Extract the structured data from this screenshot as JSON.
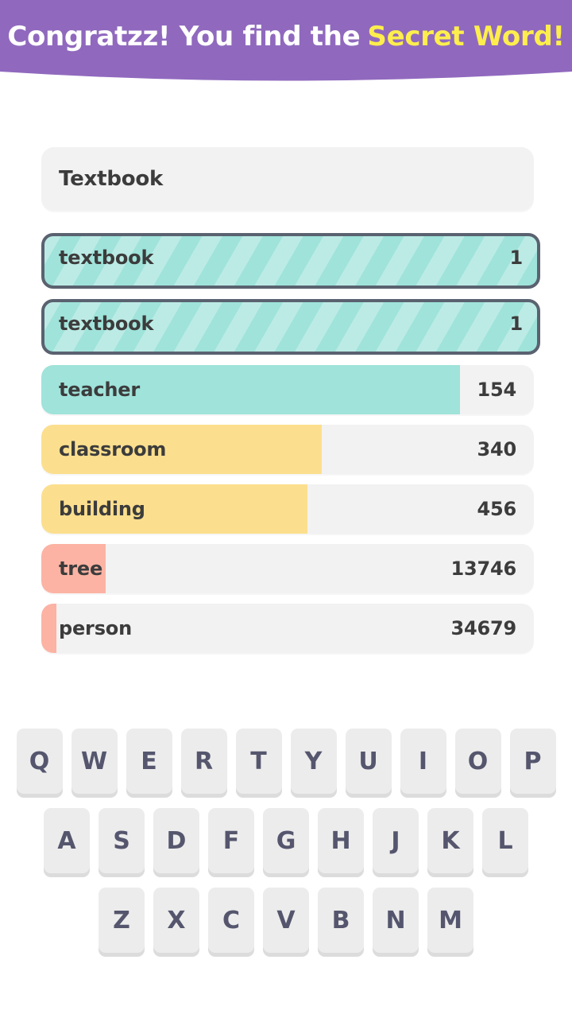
{
  "header": {
    "title_main": "Congratzz! You find the",
    "title_accent": "Secret Word!",
    "bg_color": "#9069be",
    "accent_color": "#fdee4d",
    "text_color": "#ffffff"
  },
  "answer": {
    "value": "Textbook"
  },
  "colors": {
    "teal": "#9fe3da",
    "yellow": "#fcdf8e",
    "pink": "#fcb3a3",
    "track": "#f2f2f2",
    "border": "#5a6270",
    "text": "#3c3c3c",
    "key_face": "#ececec",
    "key_shadow": "#dcdcdc",
    "key_text": "#55566e"
  },
  "guesses": [
    {
      "word": "textbook",
      "count": "1",
      "fill_percent": 100,
      "color": "#9fe3da",
      "highlighted": true,
      "striped": true
    },
    {
      "word": "textbook",
      "count": "1",
      "fill_percent": 100,
      "color": "#9fe3da",
      "highlighted": true,
      "striped": true
    },
    {
      "word": "teacher",
      "count": "154",
      "fill_percent": 85,
      "color": "#9fe3da",
      "highlighted": false,
      "striped": false
    },
    {
      "word": "classroom",
      "count": "340",
      "fill_percent": 57,
      "color": "#fcdf8e",
      "highlighted": false,
      "striped": false
    },
    {
      "word": "building",
      "count": "456",
      "fill_percent": 54,
      "color": "#fcdf8e",
      "highlighted": false,
      "striped": false
    },
    {
      "word": "tree",
      "count": "13746",
      "fill_percent": 13,
      "color": "#fcb3a3",
      "highlighted": false,
      "striped": false
    },
    {
      "word": "person",
      "count": "34679",
      "fill_percent": 3,
      "color": "#fcb3a3",
      "highlighted": false,
      "striped": false
    }
  ],
  "keyboard": {
    "rows": [
      [
        "Q",
        "W",
        "E",
        "R",
        "T",
        "Y",
        "U",
        "I",
        "O",
        "P"
      ],
      [
        "A",
        "S",
        "D",
        "F",
        "G",
        "H",
        "J",
        "K",
        "L"
      ],
      [
        "Z",
        "X",
        "C",
        "V",
        "B",
        "N",
        "M"
      ]
    ]
  }
}
